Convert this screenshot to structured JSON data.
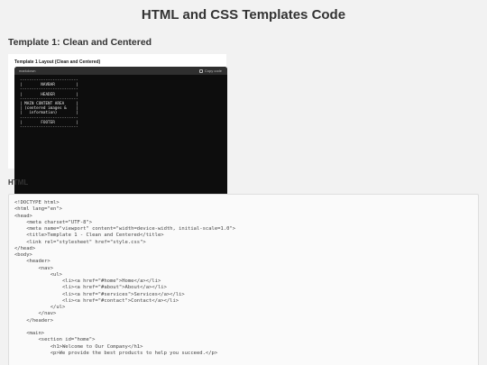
{
  "page": {
    "title": "HTML and CSS Templates Code",
    "template_heading": "Template 1: Clean and Centered",
    "code_heading": "HTML"
  },
  "figure": {
    "caption": "Template 1 Layout (Clean and Centered)",
    "lang_label": "markdown",
    "copy_label": "Copy code",
    "diagram_lines": [
      "-------------------------",
      "|        NAVBAR         |",
      "-------------------------",
      "|        HEADER         |",
      "-------------------------",
      "| MAIN CONTENT AREA     |",
      "| (centered images &    |",
      "|   information)        |",
      "-------------------------",
      "|        FOOTER         |",
      "-------------------------"
    ]
  },
  "code": {
    "lines": [
      "<!DOCTYPE html>",
      "<html lang=\"en\">",
      "<head>",
      "    <meta charset=\"UTF-8\">",
      "    <meta name=\"viewport\" content=\"width=device-width, initial-scale=1.0\">",
      "    <title>Template 1 - Clean and Centered</title>",
      "    <link rel=\"stylesheet\" href=\"style.css\">",
      "</head>",
      "<body>",
      "    <header>",
      "        <nav>",
      "            <ul>",
      "                <li><a href=\"#home\">Home</a></li>",
      "                <li><a href=\"#about\">About</a></li>",
      "                <li><a href=\"#services\">Services</a></li>",
      "                <li><a href=\"#contact\">Contact</a></li>",
      "            </ul>",
      "        </nav>",
      "    </header>",
      "",
      "    <main>",
      "        <section id=\"home\">",
      "            <h1>Welcome to Our Company</h1>",
      "            <p>We provide the best products to help you succeed.</p>"
    ]
  },
  "colors": {
    "background": "#f2f2f2",
    "code_background": "#fafafa",
    "diagram_background": "#0d0d0d"
  }
}
